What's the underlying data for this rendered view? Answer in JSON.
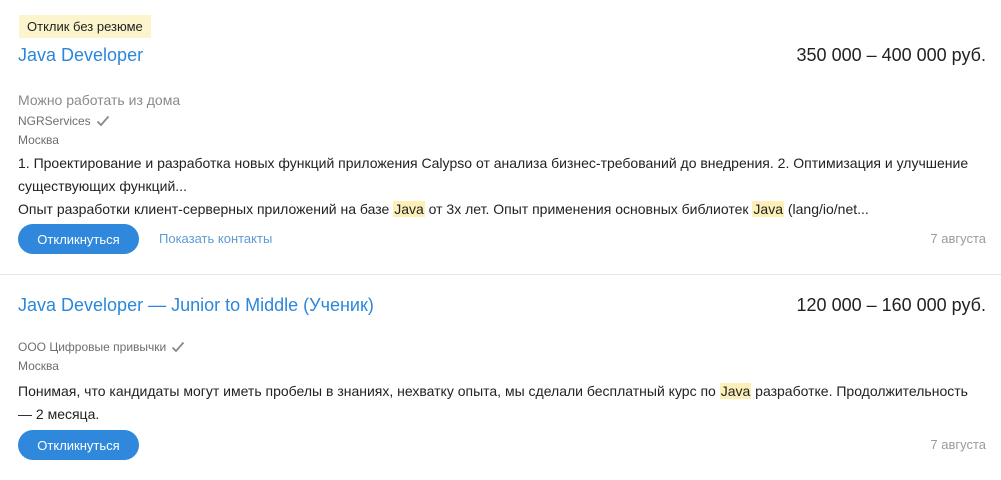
{
  "vacancies": [
    {
      "badge": "Отклик без резюме",
      "title": "Java Developer",
      "salary": "350 000 – 400 000 руб.",
      "remote": "Можно работать из дома",
      "employer": "NGRServices",
      "city": "Москва",
      "responsibility": "1. Проектирование и разработка новых функций приложения Calypso от анализа бизнес-требований до внедрения. 2. Оптимизация и улучшение существующих функций...",
      "requirement": [
        "Опыт разработки клиент-серверных приложений на базе ",
        "Java",
        " от 3х лет. Опыт применения основных библиотек ",
        "Java",
        " (lang/io/net..."
      ],
      "apply_label": "Откликнуться",
      "contacts_label": "Показать контакты",
      "date": "7 августа"
    },
    {
      "title": "Java Developer — Junior to Middle (Ученик)",
      "salary": "120 000 – 160 000 руб.",
      "employer": "ООО Цифровые привычки",
      "city": "Москва",
      "description": [
        "Понимая, что кандидаты могут иметь пробелы в знаниях, нехватку опыта, мы сделали бесплатный курс по ",
        "Java",
        " разработке. Продолжительность — 2 месяца."
      ],
      "apply_label": "Откликнуться",
      "date": "7 августа"
    }
  ],
  "colors": {
    "link": "#2b87db",
    "button": "#2f88db",
    "highlight": "#fcf0b8",
    "badge_bg": "#fcf4cc"
  },
  "icons": {
    "verified": "checkmark-icon"
  }
}
